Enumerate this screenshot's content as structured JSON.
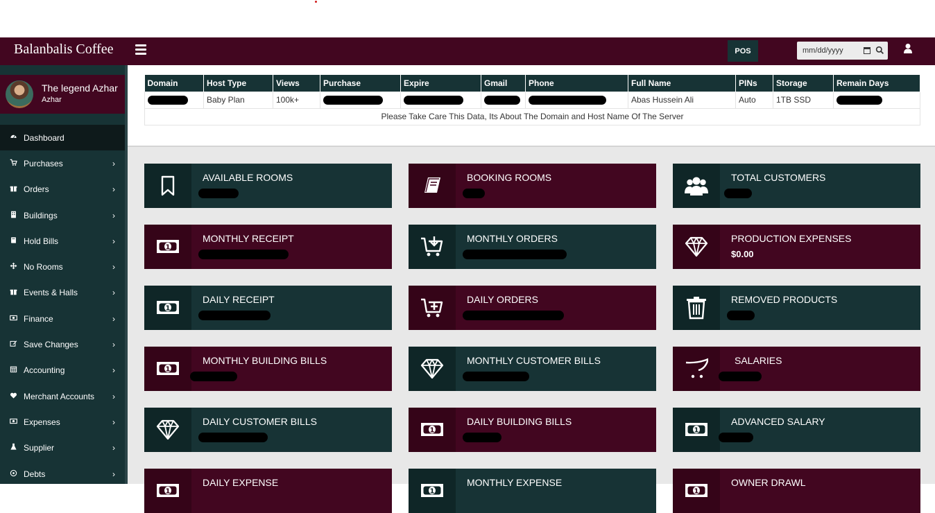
{
  "app": {
    "brand": "Balanbalis Coffee"
  },
  "navbar": {
    "pos_label": "POS",
    "date_placeholder": "mm/dd/yyyy"
  },
  "profile": {
    "name": "The legend Azhar",
    "sub": "Azhar"
  },
  "sidebar": {
    "items": [
      {
        "label": "Dashboard",
        "icon": "dashboard-icon"
      },
      {
        "label": "Purchases",
        "icon": "cart-icon"
      },
      {
        "label": "Orders",
        "icon": "gift-icon"
      },
      {
        "label": "Buildings",
        "icon": "building-icon"
      },
      {
        "label": "Hold Bills",
        "icon": "book-icon"
      },
      {
        "label": "No Rooms",
        "icon": "arrows-icon"
      },
      {
        "label": "Events & Halls",
        "icon": "gift-icon"
      },
      {
        "label": "Finance",
        "icon": "money-icon"
      },
      {
        "label": "Save Changes",
        "icon": "edit-icon"
      },
      {
        "label": "Accounting",
        "icon": "calendar-icon"
      },
      {
        "label": "Merchant Accounts",
        "icon": "heart-icon"
      },
      {
        "label": "Expenses",
        "icon": "money-icon"
      },
      {
        "label": "Supplier",
        "icon": "flask-icon"
      },
      {
        "label": "Debts",
        "icon": "circle-icon"
      }
    ]
  },
  "server_table": {
    "headers": [
      "Domain",
      "Host Type",
      "Views",
      "Purchase",
      "Expire",
      "Gmail",
      "Phone",
      "Full Name",
      "PINs",
      "Storage",
      "Remain Days"
    ],
    "row": {
      "host_type": "Baby Plan",
      "views": "100k+",
      "full_name": "Abas Hussein Ali",
      "pins": "Auto",
      "storage": "1TB SSD"
    },
    "note": "Please Take Care This Data, Its About The Domain and Host Name Of The Server"
  },
  "boxes": [
    {
      "title": "AVAILABLE ROOMS",
      "value": "",
      "icon": "bookmark-icon",
      "color": "#173335"
    },
    {
      "title": "BOOKING ROOMS",
      "value": "",
      "icon": "book-icon",
      "color": "#420620"
    },
    {
      "title": "TOTAL CUSTOMERS",
      "value": "",
      "icon": "users-icon",
      "color": "#173335"
    },
    {
      "title": "MONTHLY RECEIPT",
      "value": "",
      "icon": "money-icon",
      "color": "#420620"
    },
    {
      "title": "MONTHLY ORDERS",
      "value": "",
      "icon": "cart-download-icon",
      "color": "#173335"
    },
    {
      "title": "PRODUCTION EXPENSES",
      "value": "$0.00",
      "icon": "diamond-icon",
      "color": "#420620"
    },
    {
      "title": "DAILY RECEIPT",
      "value": "",
      "icon": "money-icon",
      "color": "#173335"
    },
    {
      "title": "DAILY ORDERS",
      "value": "",
      "icon": "cart-plus-icon",
      "color": "#420620"
    },
    {
      "title": "REMOVED PRODUCTS",
      "value": "",
      "icon": "trash-icon",
      "color": "#173335"
    },
    {
      "title": "MONTHLY BUILDING BILLS",
      "value": "",
      "icon": "money-icon",
      "color": "#420620"
    },
    {
      "title": "MONTHLY CUSTOMER BILLS",
      "value": "",
      "icon": "diamond-icon",
      "color": "#173335"
    },
    {
      "title": "SALARIES",
      "value": "",
      "icon": "opencart-icon",
      "color": "#420620"
    },
    {
      "title": "DAILY CUSTOMER BILLS",
      "value": "",
      "icon": "diamond-icon",
      "color": "#173335"
    },
    {
      "title": "DAILY BUILDING BILLS",
      "value": "",
      "icon": "money-icon",
      "color": "#420620"
    },
    {
      "title": "ADVANCED SALARY",
      "value": "",
      "icon": "money-icon",
      "color": "#173335"
    },
    {
      "title": "DAILY EXPENSE",
      "value": "",
      "icon": "money-icon",
      "color": "#420620"
    },
    {
      "title": "MONTHLY EXPENSE",
      "value": "",
      "icon": "money-icon",
      "color": "#173335"
    },
    {
      "title": "OWNER DRAWL",
      "value": "",
      "icon": "money-icon",
      "color": "#420620"
    }
  ]
}
